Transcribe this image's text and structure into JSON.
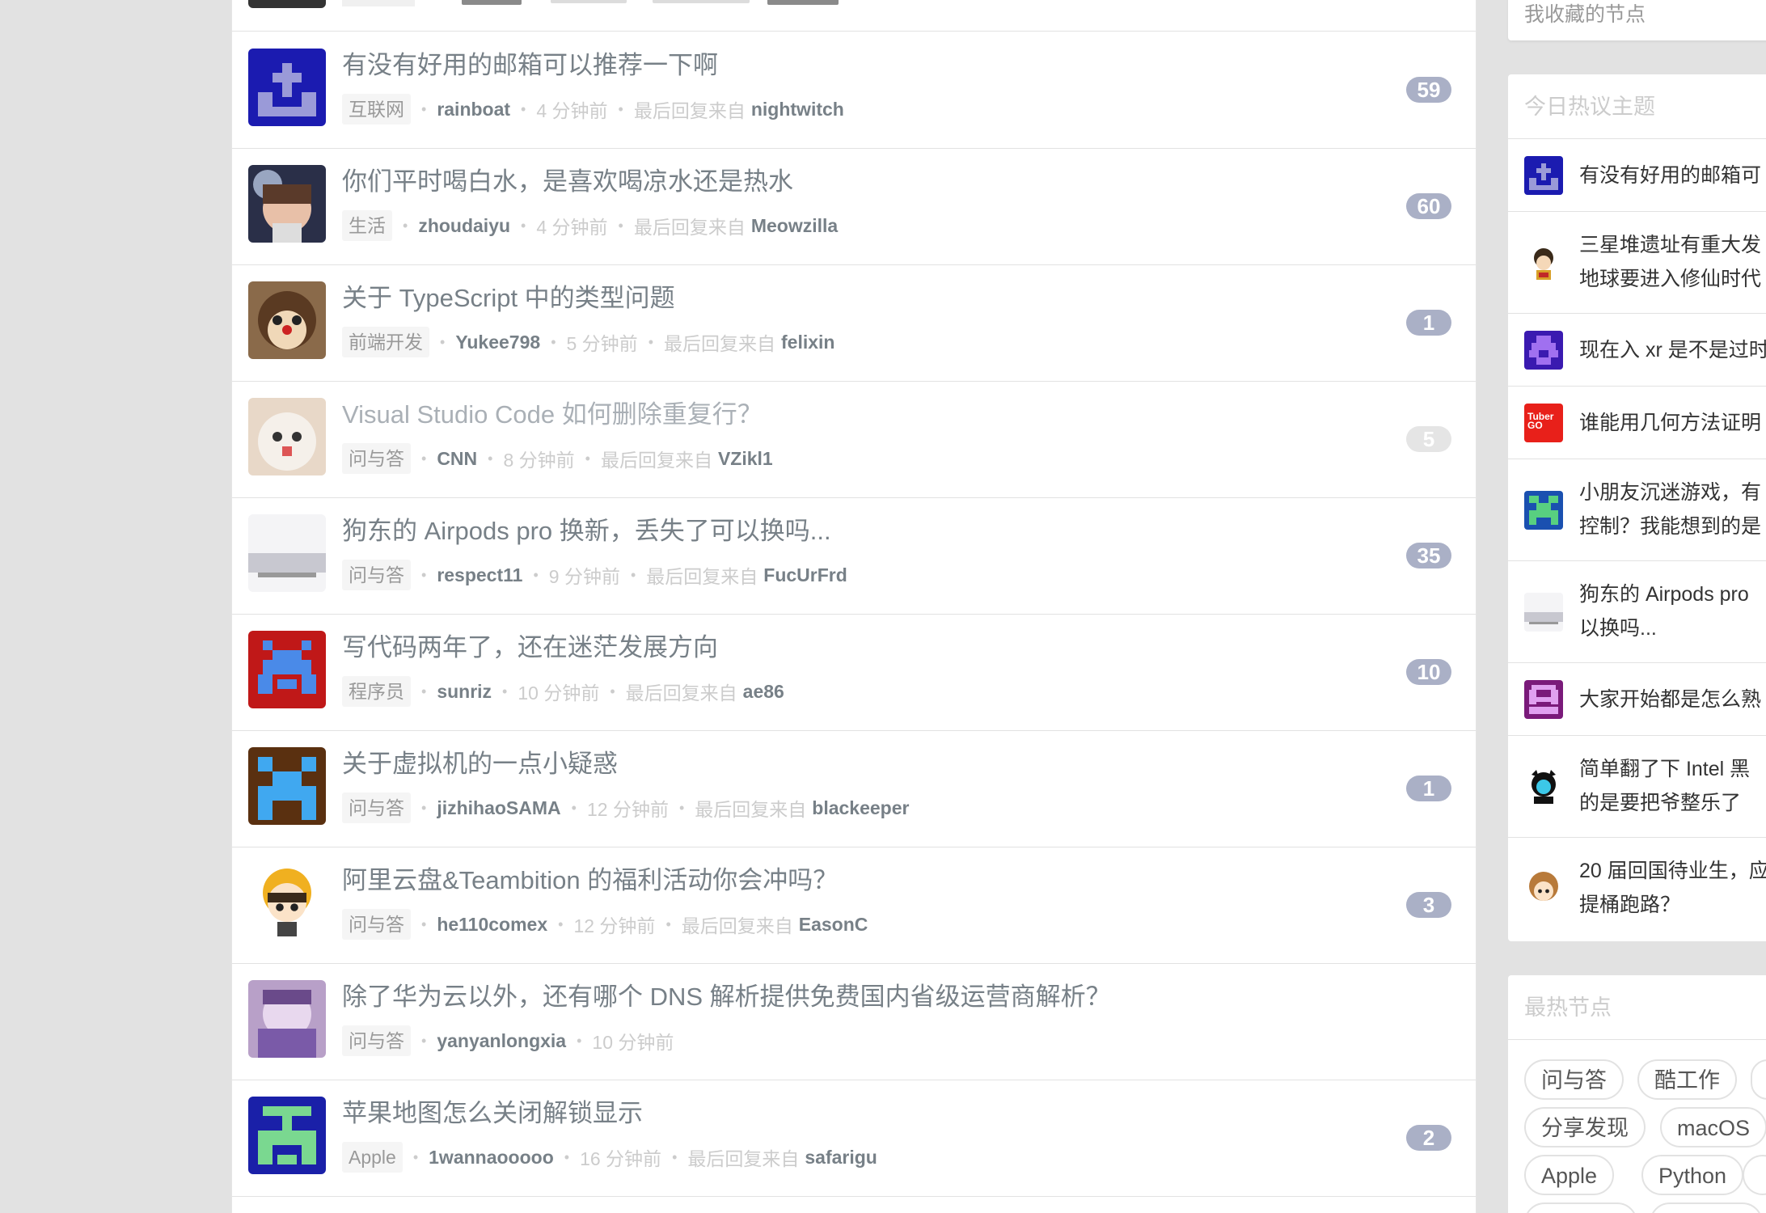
{
  "topics": [
    {
      "title": "有没有好用的邮箱可以推荐一下啊",
      "node": "互联网",
      "author": "rainboat",
      "time": "4 分钟前",
      "last_reply_label": "最后回复来自",
      "last_reply_user": "nightwitch",
      "replies": "59"
    },
    {
      "title": "你们平时喝白水，是喜欢喝凉水还是热水",
      "node": "生活",
      "author": "zhoudaiyu",
      "time": "4 分钟前",
      "last_reply_label": "最后回复来自",
      "last_reply_user": "Meowzilla",
      "replies": "60"
    },
    {
      "title": "关于 TypeScript 中的类型问题",
      "node": "前端开发",
      "author": "Yukee798",
      "time": "5 分钟前",
      "last_reply_label": "最后回复来自",
      "last_reply_user": "felixin",
      "replies": "1"
    },
    {
      "title": "Visual Studio Code 如何删除重复行？",
      "node": "问与答",
      "author": "CNN",
      "time": "8 分钟前",
      "last_reply_label": "最后回复来自",
      "last_reply_user": "VZikl1",
      "replies": "5"
    },
    {
      "title": "狗东的 Airpods pro 换新，丢失了可以换吗...",
      "node": "问与答",
      "author": "respect11",
      "time": "9 分钟前",
      "last_reply_label": "最后回复来自",
      "last_reply_user": "FucUrFrd",
      "replies": "35"
    },
    {
      "title": "写代码两年了，还在迷茫发展方向",
      "node": "程序员",
      "author": "sunriz",
      "time": "10 分钟前",
      "last_reply_label": "最后回复来自",
      "last_reply_user": "ae86",
      "replies": "10"
    },
    {
      "title": "关于虚拟机的一点小疑惑",
      "node": "问与答",
      "author": "jizhihaoSAMA",
      "time": "12 分钟前",
      "last_reply_label": "最后回复来自",
      "last_reply_user": "blackeeper",
      "replies": "1"
    },
    {
      "title": "阿里云盘&Teambition 的福利活动你会冲吗？",
      "node": "问与答",
      "author": "he110comex",
      "time": "12 分钟前",
      "last_reply_label": "最后回复来自",
      "last_reply_user": "EasonC",
      "replies": "3"
    },
    {
      "title": "除了华为云以外，还有哪个 DNS 解析提供免费国内省级运营商解析？",
      "node": "问与答",
      "author": "yanyanlongxia",
      "time": "10 分钟前"
    },
    {
      "title": "苹果地图怎么关闭解锁显示",
      "node": "Apple",
      "author": "1wannaooooo",
      "time": "16 分钟前",
      "last_reply_label": "最后回复来自",
      "last_reply_user": "safarigu",
      "replies": "2"
    }
  ],
  "sidebar": {
    "fav_nodes_label": "我收藏的节点",
    "hot_title": "今日热议主题",
    "hot_topics": [
      {
        "line1": "有没有好用的邮箱可"
      },
      {
        "line1": "三星堆遗址有重大发",
        "line2": "地球要进入修仙时代"
      },
      {
        "line1": "现在入 xr 是不是过时"
      },
      {
        "line1": "谁能用几何方法证明"
      },
      {
        "line1": "小朋友沉迷游戏，有",
        "line2": "控制？我能想到的是"
      },
      {
        "line1": "狗东的 Airpods pro",
        "line2": "以换吗..."
      },
      {
        "line1": "大家开始都是怎么熟"
      },
      {
        "line1": "简单翻了下 Intel 黑",
        "line2": "的是要把爷整乐了"
      },
      {
        "line1": "20 届回国待业生，应",
        "line2": "提桶跑路？"
      }
    ],
    "tuber_logo": "Tuber GO",
    "hot_nodes_title": "最热节点",
    "hot_nodes": [
      "问与答",
      "酷工作",
      "分享发现",
      "macOS",
      "Apple",
      "Python"
    ]
  },
  "colors": {
    "reply_badge": "#aab0c6",
    "link_gray": "#778087",
    "background": "#e2e2e2"
  }
}
